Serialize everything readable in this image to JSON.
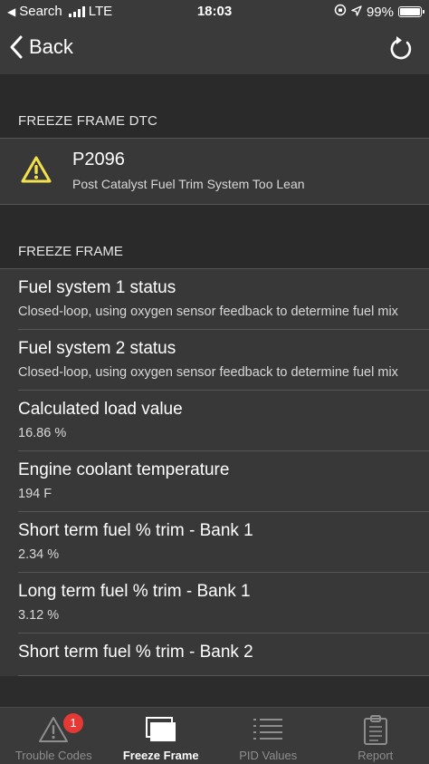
{
  "status_bar": {
    "carrier_back": "Search",
    "network": "LTE",
    "time": "18:03",
    "battery_text": "99%",
    "battery_level": 0.99
  },
  "nav": {
    "back_label": "Back"
  },
  "dtc_section": {
    "header": "FREEZE FRAME DTC",
    "code": "P2096",
    "description": "Post Catalyst Fuel Trim System Too Lean",
    "icon": "warning-icon"
  },
  "freeze_frame": {
    "header": "FREEZE FRAME",
    "items": [
      {
        "title": "Fuel system 1 status",
        "value": "Closed-loop, using oxygen sensor feedback to determine fuel mix"
      },
      {
        "title": "Fuel system 2 status",
        "value": "Closed-loop, using oxygen sensor feedback to determine fuel mix"
      },
      {
        "title": "Calculated load value",
        "value": "16.86 %"
      },
      {
        "title": "Engine coolant temperature",
        "value": "194 F"
      },
      {
        "title": "Short term fuel % trim - Bank 1",
        "value": "2.34 %"
      },
      {
        "title": "Long term fuel % trim - Bank 1",
        "value": "3.12 %"
      },
      {
        "title": "Short term fuel % trim - Bank 2",
        "value": ""
      }
    ]
  },
  "tabs": [
    {
      "label": "Trouble Codes",
      "icon": "warning-icon",
      "badge": "1"
    },
    {
      "label": "Freeze Frame",
      "icon": "frames-icon"
    },
    {
      "label": "PID Values",
      "icon": "list-icon"
    },
    {
      "label": "Report",
      "icon": "clipboard-icon"
    }
  ],
  "colors": {
    "warning_yellow": "#f2e14c",
    "badge_red": "#e53935",
    "background": "#2c2c2c",
    "row": "#383838"
  }
}
